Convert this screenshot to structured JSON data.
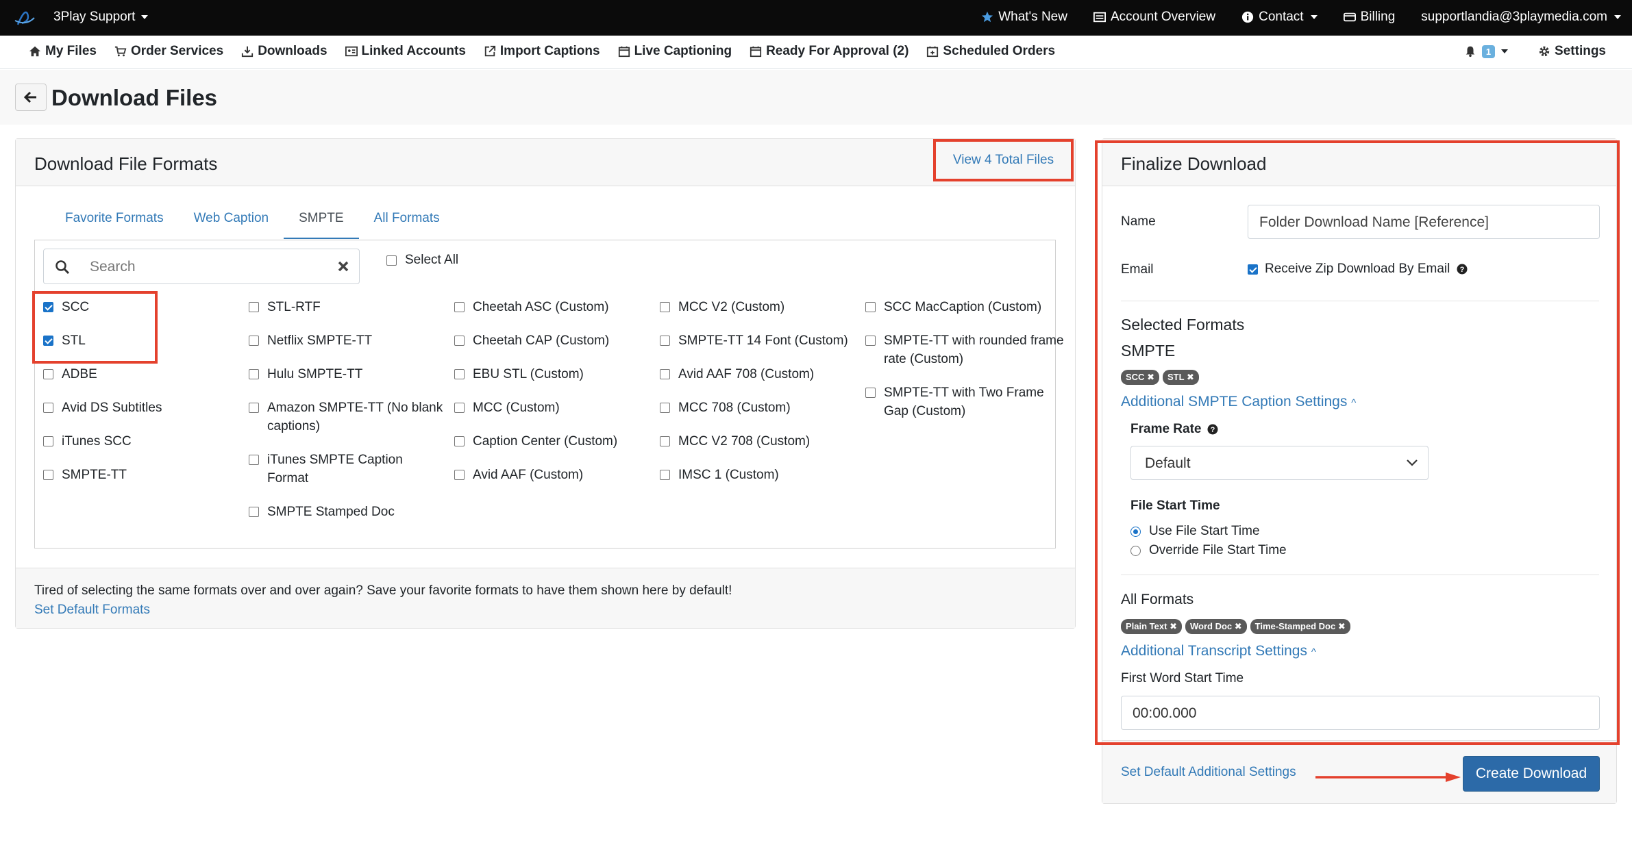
{
  "topbar": {
    "org": "3Play Support",
    "items": [
      {
        "label": "What's New",
        "icon": "star-icon"
      },
      {
        "label": "Account Overview",
        "icon": "list-icon"
      },
      {
        "label": "Contact",
        "icon": "info-icon"
      },
      {
        "label": "Billing",
        "icon": "credit-card-icon"
      },
      {
        "label": "supportlandia@3playmedia.com",
        "icon": ""
      }
    ]
  },
  "subnav": {
    "items": [
      {
        "label": "My Files",
        "icon": "home-icon"
      },
      {
        "label": "Order Services",
        "icon": "cart-icon"
      },
      {
        "label": "Downloads",
        "icon": "download-icon"
      },
      {
        "label": "Linked Accounts",
        "icon": "id-card-icon"
      },
      {
        "label": "Import Captions",
        "icon": "external-link-icon"
      },
      {
        "label": "Live Captioning",
        "icon": "calendar-icon"
      },
      {
        "label": "Ready For Approval (2)",
        "icon": "calendar-icon"
      },
      {
        "label": "Scheduled Orders",
        "icon": "calendar-plus-icon"
      }
    ],
    "notifications": "1",
    "settings": "Settings"
  },
  "page": {
    "title": "Download Files"
  },
  "formats_panel": {
    "title": "Download File Formats",
    "view_files": "View 4 Total Files",
    "tabs": [
      "Favorite Formats",
      "Web Caption",
      "SMPTE",
      "All Formats"
    ],
    "active_tab": "SMPTE",
    "search_placeholder": "Search",
    "select_all": "Select All",
    "columns": [
      [
        {
          "label": "SCC",
          "checked": true
        },
        {
          "label": "STL",
          "checked": true
        },
        {
          "label": "ADBE",
          "checked": false
        },
        {
          "label": "Avid DS Subtitles",
          "checked": false
        },
        {
          "label": "iTunes SCC",
          "checked": false
        },
        {
          "label": "SMPTE-TT",
          "checked": false
        }
      ],
      [
        {
          "label": "STL-RTF",
          "checked": false
        },
        {
          "label": "Netflix SMPTE-TT",
          "checked": false
        },
        {
          "label": "Hulu SMPTE-TT",
          "checked": false
        },
        {
          "label": "Amazon SMPTE-TT (No blank captions)",
          "checked": false
        },
        {
          "label": "iTunes SMPTE Caption Format",
          "checked": false
        },
        {
          "label": "SMPTE Stamped Doc",
          "checked": false
        }
      ],
      [
        {
          "label": "Cheetah ASC (Custom)",
          "checked": false
        },
        {
          "label": "Cheetah CAP (Custom)",
          "checked": false
        },
        {
          "label": "EBU STL (Custom)",
          "checked": false
        },
        {
          "label": "MCC (Custom)",
          "checked": false
        },
        {
          "label": "Caption Center (Custom)",
          "checked": false
        },
        {
          "label": "Avid AAF (Custom)",
          "checked": false
        }
      ],
      [
        {
          "label": "MCC V2 (Custom)",
          "checked": false
        },
        {
          "label": "SMPTE-TT 14 Font (Custom)",
          "checked": false
        },
        {
          "label": "Avid AAF 708 (Custom)",
          "checked": false
        },
        {
          "label": "MCC 708 (Custom)",
          "checked": false
        },
        {
          "label": "MCC V2 708 (Custom)",
          "checked": false
        },
        {
          "label": "IMSC 1 (Custom)",
          "checked": false
        }
      ],
      [
        {
          "label": "SCC MacCaption (Custom)",
          "checked": false
        },
        {
          "label": "SMPTE-TT with rounded frame rate (Custom)",
          "checked": false
        },
        {
          "label": "SMPTE-TT with Two Frame Gap (Custom)",
          "checked": false
        }
      ]
    ],
    "footer_text": "Tired of selecting the same formats over and over again? Save your favorite formats to have them shown here by default!",
    "footer_link": "Set Default Formats"
  },
  "finalize": {
    "title": "Finalize Download",
    "name_label": "Name",
    "name_value": "Folder Download Name [Reference]",
    "email_label": "Email",
    "email_checkbox": "Receive Zip Download By Email",
    "selected_formats": "Selected Formats",
    "smpte_heading": "SMPTE",
    "smpte_chips": [
      "SCC",
      "STL"
    ],
    "smpte_settings_link": "Additional SMPTE Caption Settings",
    "frame_rate_label": "Frame Rate",
    "frame_rate_value": "Default",
    "file_start_label": "File Start Time",
    "radio_use": "Use File Start Time",
    "radio_override": "Override File Start Time",
    "all_formats": "All Formats",
    "all_chips": [
      "Plain Text",
      "Word Doc",
      "Time-Stamped Doc"
    ],
    "transcript_settings_link": "Additional Transcript Settings",
    "first_word_label": "First Word Start Time",
    "first_word_value": "00:00.000",
    "set_default_link": "Set Default Additional Settings",
    "create_button": "Create Download"
  },
  "colors": {
    "highlight": "#e4412d",
    "link": "#337ab7",
    "primary": "#2c6aa8"
  }
}
